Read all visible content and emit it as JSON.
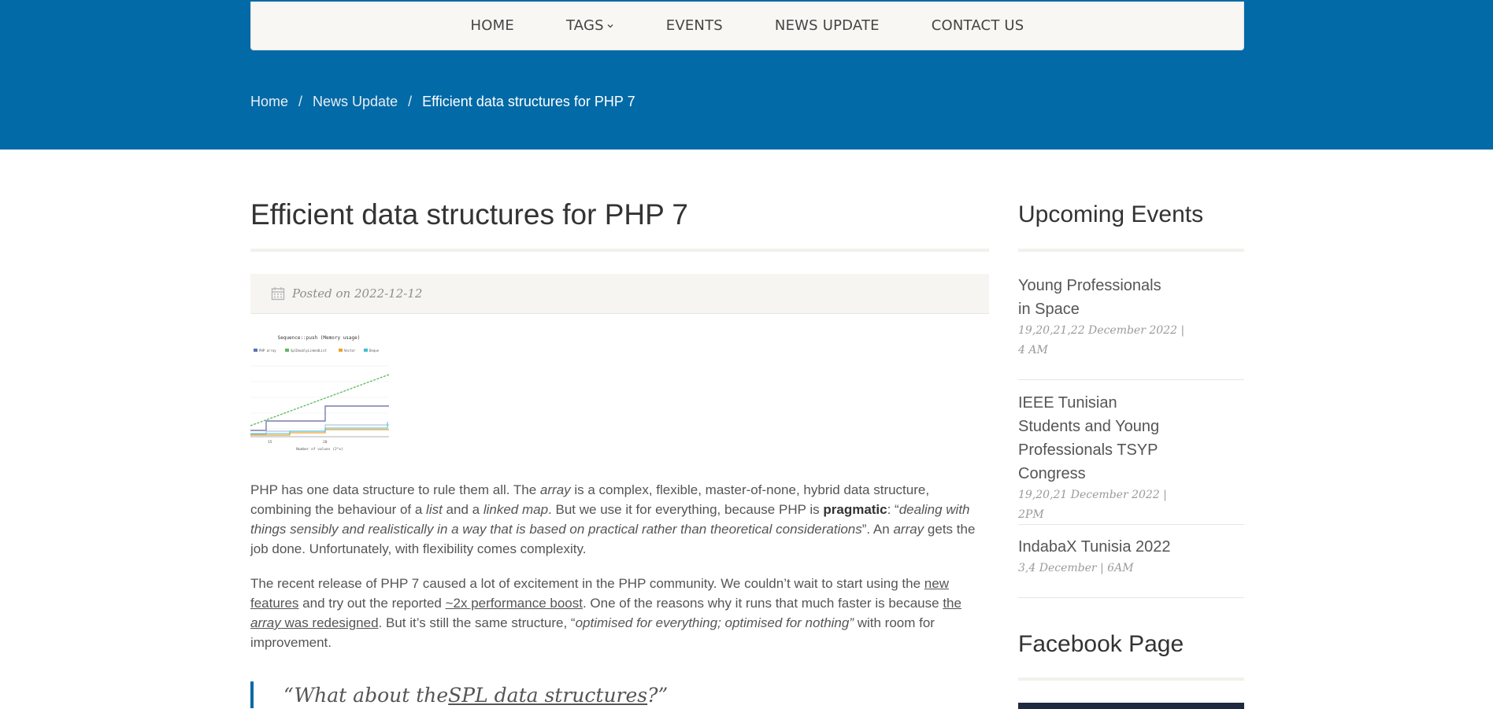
{
  "nav": {
    "items": [
      {
        "label": "HOME"
      },
      {
        "label": "TAGS"
      },
      {
        "label": "EVENTS"
      },
      {
        "label": "NEWS UPDATE"
      },
      {
        "label": "CONTACT US"
      }
    ]
  },
  "breadcrumb": {
    "home": "Home",
    "separator": "/",
    "news": "News Update",
    "current": "Efficient data structures for PHP 7"
  },
  "post": {
    "title": "Efficient data structures for PHP 7",
    "posted_prefix": "Posted on",
    "date": "2022-12-12"
  },
  "thumbnail": {
    "title": "Sequence::push (Memory usage)",
    "legend": [
      "PHP array",
      "SplDoublyLinkedList",
      "Vector",
      "Deque"
    ],
    "xlabel": "Number of values (2^x)",
    "ticks": [
      "15",
      "20"
    ],
    "colors": [
      "#5b6fb5",
      "#5fb75f",
      "#f0a030",
      "#40c0d0"
    ]
  },
  "article": {
    "p1": {
      "a": "PHP has one data structure to rule them all. The ",
      "b": "array",
      "c": " is a complex, flexible, master-of-none, hybrid data structure, combining the behaviour of a ",
      "d": "list",
      "e": " and a ",
      "f": "linked map",
      "g": ". But we use it for everything, because PHP is ",
      "h": "pragmatic",
      "i": ": “",
      "j": "dealing with things sensibly and realistically in a way that is based on practical rather than theoretical considerations",
      "k": "”. An ",
      "l": "array",
      "m": " gets the job done. Unfortunately, with flexibility comes complexity."
    },
    "p2": {
      "a": "The recent release of PHP 7 caused a lot of excitement in the PHP community. We couldn’t wait to start using the ",
      "link1": "new features",
      "b": " and try out the reported ",
      "link2": "~2x performance boost",
      "c": ". One of the reasons why it runs that much faster is because ",
      "link3a": "the ",
      "link3b": "array",
      "link3c": " was redesigned",
      "d": ". But it’s still the same structure, “",
      "e": "optimised for everything; optimised for nothing”",
      "f": " with room for improvement."
    },
    "quote": {
      "a": "“What about the ",
      "link": "SPL data structures",
      "b": "?”"
    }
  },
  "sidebar": {
    "events_heading": "Upcoming Events",
    "events": [
      {
        "title": "Young Professionals in Space",
        "date": "19,20,21,22 December 2022 | 4 AM"
      },
      {
        "title": "IEEE Tunisian Students and Young Professionals TSYP Congress",
        "date": "19,20,21 December 2022 | 2PM"
      },
      {
        "title": "IndabaX Tunisia 2022",
        "date": "3,4 December | 6AM"
      }
    ],
    "facebook_heading": "Facebook Page"
  },
  "colors": {
    "brand_blue": "#026aa7",
    "nav_bg": "#f8f7f4",
    "text": "#555555"
  }
}
